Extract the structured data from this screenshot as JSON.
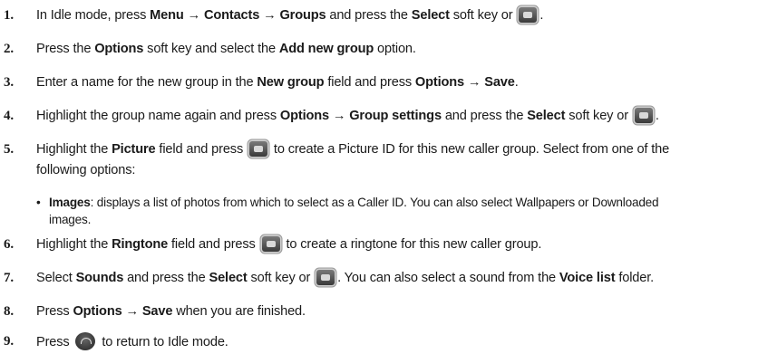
{
  "steps": [
    {
      "number": "1.",
      "parts": [
        "In Idle mode, press ",
        "Menu",
        " → ",
        "Contacts",
        " → ",
        "Groups",
        " and press the ",
        "Select",
        " soft key or ",
        "."
      ]
    },
    {
      "number": "2.",
      "parts": [
        "Press the ",
        "Options",
        " soft key and select the ",
        "Add new group",
        " option."
      ]
    },
    {
      "number": "3.",
      "parts": [
        "Enter a name for the new group in the ",
        "New group",
        " field and press ",
        "Options",
        " → ",
        "Save",
        "."
      ]
    },
    {
      "number": "4.",
      "parts": [
        "Highlight the group name again and press ",
        "Options",
        " → ",
        "Group settings",
        " and press the ",
        "Select",
        " soft key or ",
        "."
      ]
    },
    {
      "number": "5.",
      "parts": [
        "Highlight the ",
        "Picture",
        " field and press ",
        " to create a Picture ID for this new caller group. Select from one of the"
      ],
      "continuation": "following options:"
    },
    {
      "number": "6.",
      "parts": [
        "Highlight the ",
        "Ringtone",
        " field and press ",
        " to create a ringtone for this new caller group."
      ]
    },
    {
      "number": "7.",
      "parts": [
        "Select ",
        "Sounds",
        " and press the ",
        "Select",
        " soft key or ",
        ". You can also select a sound from the ",
        "Voice list",
        " folder."
      ]
    },
    {
      "number": "8.",
      "parts": [
        "Press ",
        "Options",
        " → ",
        "Save",
        " when you are finished."
      ]
    },
    {
      "number": "9.",
      "parts": [
        "Press ",
        " to return to Idle mode."
      ]
    }
  ],
  "bullet": {
    "term": "Images",
    "text": ": displays a list of photos from which to select as a Caller ID. You can also select Wallpapers or Downloaded",
    "continuation": "images."
  },
  "icons": {
    "select_key": "ok-key-icon",
    "end_key": "end-key-icon"
  }
}
